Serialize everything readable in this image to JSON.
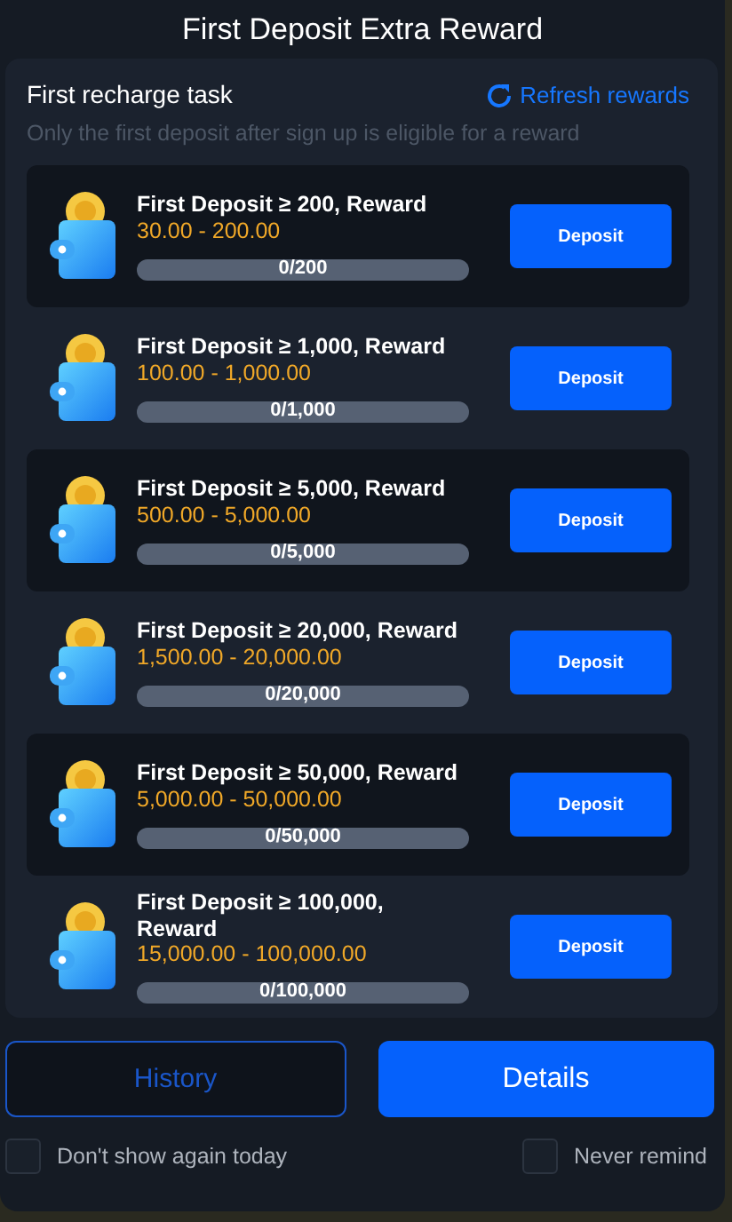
{
  "title": "First Deposit Extra Reward",
  "task": {
    "title": "First recharge task",
    "refresh": "Refresh rewards",
    "note": "Only the first deposit after sign up is eligible for a reward"
  },
  "rows": [
    {
      "title": "First Deposit ≥ 200, Reward",
      "range": "30.00 - 200.00",
      "progress": "0/200",
      "level": 0,
      "button": "Deposit"
    },
    {
      "title": "First Deposit ≥ 1,000, Reward",
      "range": "100.00 - 1,000.00",
      "progress": "0/1,000",
      "level": 0,
      "button": "Deposit"
    },
    {
      "title": "First Deposit ≥ 5,000, Reward",
      "range": "500.00 - 5,000.00",
      "progress": "0/5,000",
      "level": 0,
      "button": "Deposit"
    },
    {
      "title": "First Deposit ≥ 20,000, Reward",
      "range": "1,500.00 - 20,000.00",
      "progress": "0/20,000",
      "level": 0,
      "button": "Deposit"
    },
    {
      "title": "First Deposit ≥ 50,000, Reward",
      "range": "5,000.00 - 50,000.00",
      "progress": "0/50,000",
      "level": 0,
      "button": "Deposit"
    },
    {
      "title": "First Deposit ≥ 100,000, Reward",
      "range": "15,000.00 - 100,000.00",
      "progress": "0/100,000",
      "level": 0,
      "button": "Deposit"
    }
  ],
  "buttons": [
    {
      "label": "History",
      "kind": "outline"
    },
    {
      "label": "Details",
      "kind": "solid"
    }
  ],
  "options": [
    {
      "label": "Don't show again today",
      "checked": false
    },
    {
      "label": "Never remind",
      "checked": false
    }
  ]
}
